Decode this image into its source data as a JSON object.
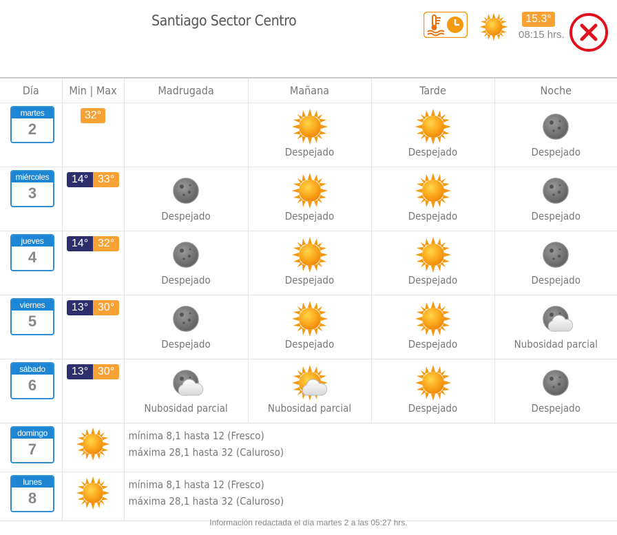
{
  "header": {
    "title": "Santiago Sector Centro",
    "current_temp": "15.3°",
    "current_time": "08:15 hrs.",
    "icons": [
      "thermometer-clock-icon",
      "sun-icon",
      "close-icon"
    ]
  },
  "columns": [
    "Día",
    "Min | Max",
    "Madrugada",
    "Mañana",
    "Tarde",
    "Noche"
  ],
  "days": [
    {
      "name": "martes",
      "num": "2",
      "min": "",
      "max": "32°",
      "periods": [
        null,
        {
          "icon": "sun",
          "label": "Despejado"
        },
        {
          "icon": "sun",
          "label": "Despejado"
        },
        {
          "icon": "moon",
          "label": "Despejado"
        }
      ]
    },
    {
      "name": "miércoles",
      "num": "3",
      "min": "14°",
      "max": "33°",
      "periods": [
        {
          "icon": "moon",
          "label": "Despejado"
        },
        {
          "icon": "sun",
          "label": "Despejado"
        },
        {
          "icon": "sun",
          "label": "Despejado"
        },
        {
          "icon": "moon",
          "label": "Despejado"
        }
      ]
    },
    {
      "name": "jueves",
      "num": "4",
      "min": "14°",
      "max": "32°",
      "periods": [
        {
          "icon": "moon",
          "label": "Despejado"
        },
        {
          "icon": "sun",
          "label": "Despejado"
        },
        {
          "icon": "sun",
          "label": "Despejado"
        },
        {
          "icon": "moon",
          "label": "Despejado"
        }
      ]
    },
    {
      "name": "viernes",
      "num": "5",
      "min": "13°",
      "max": "30°",
      "periods": [
        {
          "icon": "moon",
          "label": "Despejado"
        },
        {
          "icon": "sun",
          "label": "Despejado"
        },
        {
          "icon": "sun",
          "label": "Despejado"
        },
        {
          "icon": "moon-cloud",
          "label": "Nubosidad parcial"
        }
      ]
    },
    {
      "name": "sábado",
      "num": "6",
      "min": "13°",
      "max": "30°",
      "periods": [
        {
          "icon": "moon-cloud",
          "label": "Nubosidad parcial"
        },
        {
          "icon": "sun-cloud",
          "label": "Nubosidad parcial"
        },
        {
          "icon": "sun",
          "label": "Despejado"
        },
        {
          "icon": "moon",
          "label": "Despejado"
        }
      ]
    }
  ],
  "extended": [
    {
      "name": "domingo",
      "num": "7",
      "icon": "sun",
      "line1": "mínima 8,1 hasta 12 (Fresco)",
      "line2": "máxima 28,1 hasta 32 (Caluroso)"
    },
    {
      "name": "lunes",
      "num": "8",
      "icon": "sun",
      "line1": "mínima 8,1 hasta 12 (Fresco)",
      "line2": "máxima 28,1 hasta 32 (Caluroso)"
    }
  ],
  "footer": "Información redactada el día martes 2 a las 05:27 hrs.",
  "colors": {
    "accent": "#f8a135",
    "day_blue": "#1d86d4",
    "min_navy": "#2c2f6b",
    "close_red": "#e0101e"
  }
}
